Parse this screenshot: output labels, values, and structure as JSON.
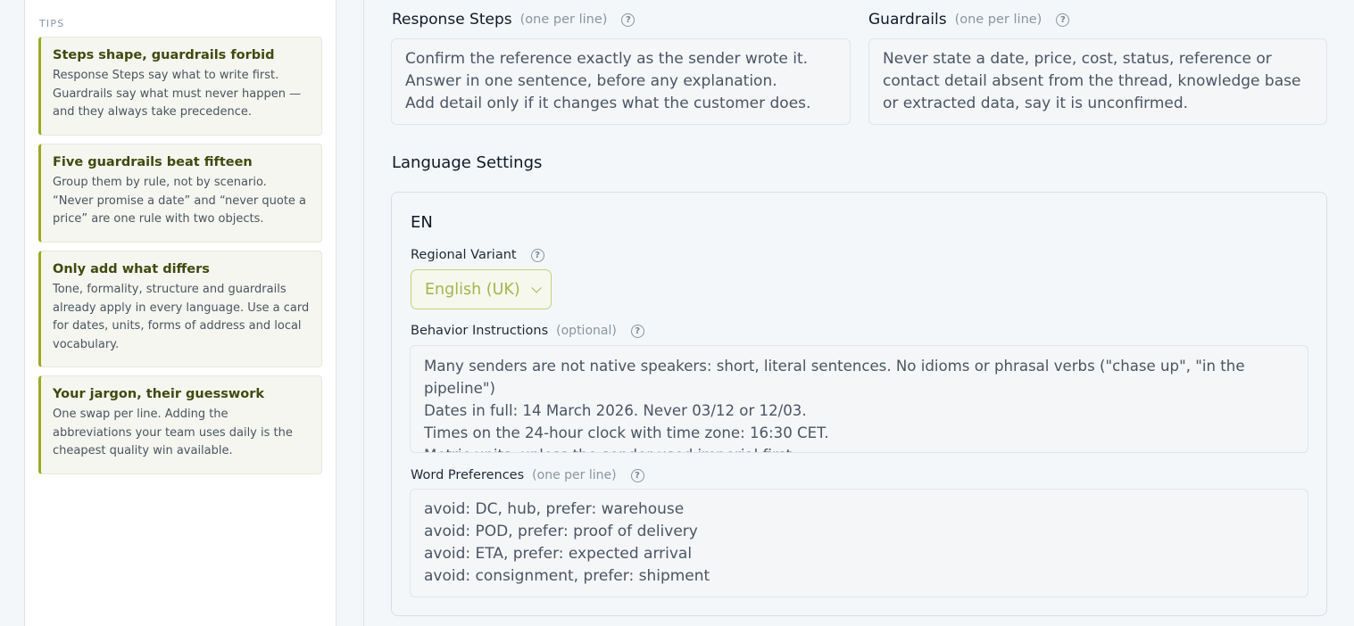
{
  "sidebar": {
    "tips_heading": "TIPS",
    "tips": [
      {
        "title": "Steps shape, guardrails forbid",
        "body": "Response Steps say what to write first. Guardrails say what must never happen — and they always take precedence."
      },
      {
        "title": "Five guardrails beat fifteen",
        "body": "Group them by rule, not by scenario. “Never promise a date” and “never quote a price” are one rule with two objects."
      },
      {
        "title": "Only add what differs",
        "body": "Tone, formality, structure and guardrails already apply in every language. Use a card for dates, units, forms of address and local vocabulary."
      },
      {
        "title": "Your jargon, their guesswork",
        "body": "One swap per line. Adding the abbreviations your team uses daily is the cheapest quality win available."
      }
    ]
  },
  "response_steps": {
    "label": "Response Steps",
    "hint": "(one per line)",
    "value": "Confirm the reference exactly as the sender wrote it.\nAnswer in one sentence, before any explanation.\nAdd detail only if it changes what the customer does."
  },
  "guardrails": {
    "label": "Guardrails",
    "hint": "(one per line)",
    "value": "Never state a date, price, cost, status, reference or contact detail absent from the thread, knowledge base or extracted data, say it is unconfirmed."
  },
  "language_settings": {
    "title": "Language Settings",
    "code": "EN",
    "regional_variant": {
      "label": "Regional Variant",
      "value": "English (UK)"
    },
    "behavior_instructions": {
      "label": "Behavior Instructions",
      "hint": "(optional)",
      "value": "Many senders are not native speakers: short, literal sentences. No idioms or phrasal verbs (\"chase up\", \"in the pipeline\")\nDates in full: 14 March 2026. Never 03/12 or 12/03.\nTimes on the 24-hour clock with time zone: 16:30 CET.\nMetric units, unless the sender used imperial first."
    },
    "word_preferences": {
      "label": "Word Preferences",
      "hint": "(one per line)",
      "value": "avoid: DC, hub, prefer: warehouse\navoid: POD, prefer: proof of delivery\navoid: ETA, prefer: expected arrival\navoid: consignment, prefer: shipment"
    }
  },
  "icons": {
    "help": "?"
  },
  "colors": {
    "accent": "#9cab22",
    "tip_title": "#3f4a10",
    "select_text": "#a6b44a"
  }
}
